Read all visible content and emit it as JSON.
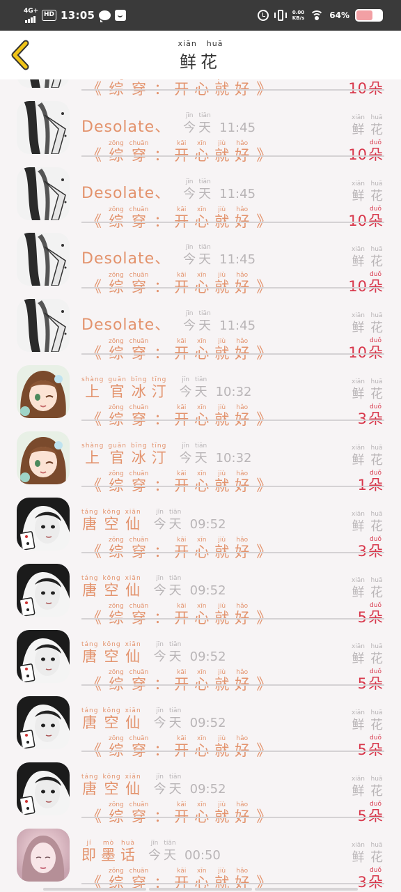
{
  "status_bar": {
    "network": "4G+",
    "hd": "HD",
    "time": "13:05",
    "speed_value": "0.00",
    "speed_unit": "KB/s",
    "battery": "64%"
  },
  "header": {
    "back_icon": "chevron-left-icon",
    "title": [
      {
        "py": "xiān",
        "hz": "鲜"
      },
      {
        "py": "huā",
        "hz": "花"
      }
    ]
  },
  "colors": {
    "name": "#e3936d",
    "count": "#d8374b",
    "muted": "#b9b5b7",
    "back": "#f0c419"
  },
  "common": {
    "today": [
      {
        "py": "jīn",
        "hz": "今"
      },
      {
        "py": "tiān",
        "hz": "天"
      }
    ],
    "work_title": [
      {
        "py": "zōng",
        "hz": "综"
      },
      {
        "py": "chuān",
        "hz": "穿"
      },
      {
        "py": "",
        "hz": "："
      },
      {
        "py": "kāi",
        "hz": "开"
      },
      {
        "py": "xīn",
        "hz": "心"
      },
      {
        "py": "jiù",
        "hz": "就"
      },
      {
        "py": "hǎo",
        "hz": "好"
      }
    ],
    "quote_open": "《",
    "quote_close": "》",
    "flower": [
      {
        "py": "xiān",
        "hz": "鲜"
      },
      {
        "py": "huā",
        "hz": "花"
      }
    ],
    "unit": {
      "py": "duǒ",
      "hz": "朵"
    }
  },
  "rows": [
    {
      "name_text": "",
      "name_han": [],
      "time": "",
      "count": "10",
      "avatar": "sketch"
    },
    {
      "name_text": "Desolate、",
      "name_han": [],
      "time": "11:45",
      "count": "10",
      "avatar": "sketch"
    },
    {
      "name_text": "Desolate、",
      "name_han": [],
      "time": "11:45",
      "count": "10",
      "avatar": "sketch"
    },
    {
      "name_text": "Desolate、",
      "name_han": [],
      "time": "11:45",
      "count": "10",
      "avatar": "sketch"
    },
    {
      "name_text": "Desolate、",
      "name_han": [],
      "time": "11:45",
      "count": "10",
      "avatar": "sketch"
    },
    {
      "name_text": "",
      "name_han": [
        {
          "py": "shàng",
          "hz": "上"
        },
        {
          "py": "guān",
          "hz": "官"
        },
        {
          "py": "bīng",
          "hz": "冰"
        },
        {
          "py": "tīng",
          "hz": "汀"
        }
      ],
      "time": "10:32",
      "count": "3",
      "avatar": "girl"
    },
    {
      "name_text": "",
      "name_han": [
        {
          "py": "shàng",
          "hz": "上"
        },
        {
          "py": "guān",
          "hz": "官"
        },
        {
          "py": "bīng",
          "hz": "冰"
        },
        {
          "py": "tīng",
          "hz": "汀"
        }
      ],
      "time": "10:32",
      "count": "1",
      "avatar": "girl"
    },
    {
      "name_text": "",
      "name_han": [
        {
          "py": "táng",
          "hz": "唐"
        },
        {
          "py": "kōng",
          "hz": "空"
        },
        {
          "py": "xiān",
          "hz": "仙"
        }
      ],
      "time": "09:52",
      "count": "3",
      "avatar": "dark"
    },
    {
      "name_text": "",
      "name_han": [
        {
          "py": "táng",
          "hz": "唐"
        },
        {
          "py": "kōng",
          "hz": "空"
        },
        {
          "py": "xiān",
          "hz": "仙"
        }
      ],
      "time": "09:52",
      "count": "5",
      "avatar": "dark"
    },
    {
      "name_text": "",
      "name_han": [
        {
          "py": "táng",
          "hz": "唐"
        },
        {
          "py": "kōng",
          "hz": "空"
        },
        {
          "py": "xiān",
          "hz": "仙"
        }
      ],
      "time": "09:52",
      "count": "5",
      "avatar": "dark"
    },
    {
      "name_text": "",
      "name_han": [
        {
          "py": "táng",
          "hz": "唐"
        },
        {
          "py": "kōng",
          "hz": "空"
        },
        {
          "py": "xiān",
          "hz": "仙"
        }
      ],
      "time": "09:52",
      "count": "5",
      "avatar": "dark"
    },
    {
      "name_text": "",
      "name_han": [
        {
          "py": "táng",
          "hz": "唐"
        },
        {
          "py": "kōng",
          "hz": "空"
        },
        {
          "py": "xiān",
          "hz": "仙"
        }
      ],
      "time": "09:52",
      "count": "5",
      "avatar": "dark"
    },
    {
      "name_text": "",
      "name_han": [
        {
          "py": "jí",
          "hz": "即"
        },
        {
          "py": "mò",
          "hz": "墨"
        },
        {
          "py": "huà",
          "hz": "话"
        }
      ],
      "time": "00:50",
      "count": "3",
      "avatar": "pink"
    }
  ]
}
